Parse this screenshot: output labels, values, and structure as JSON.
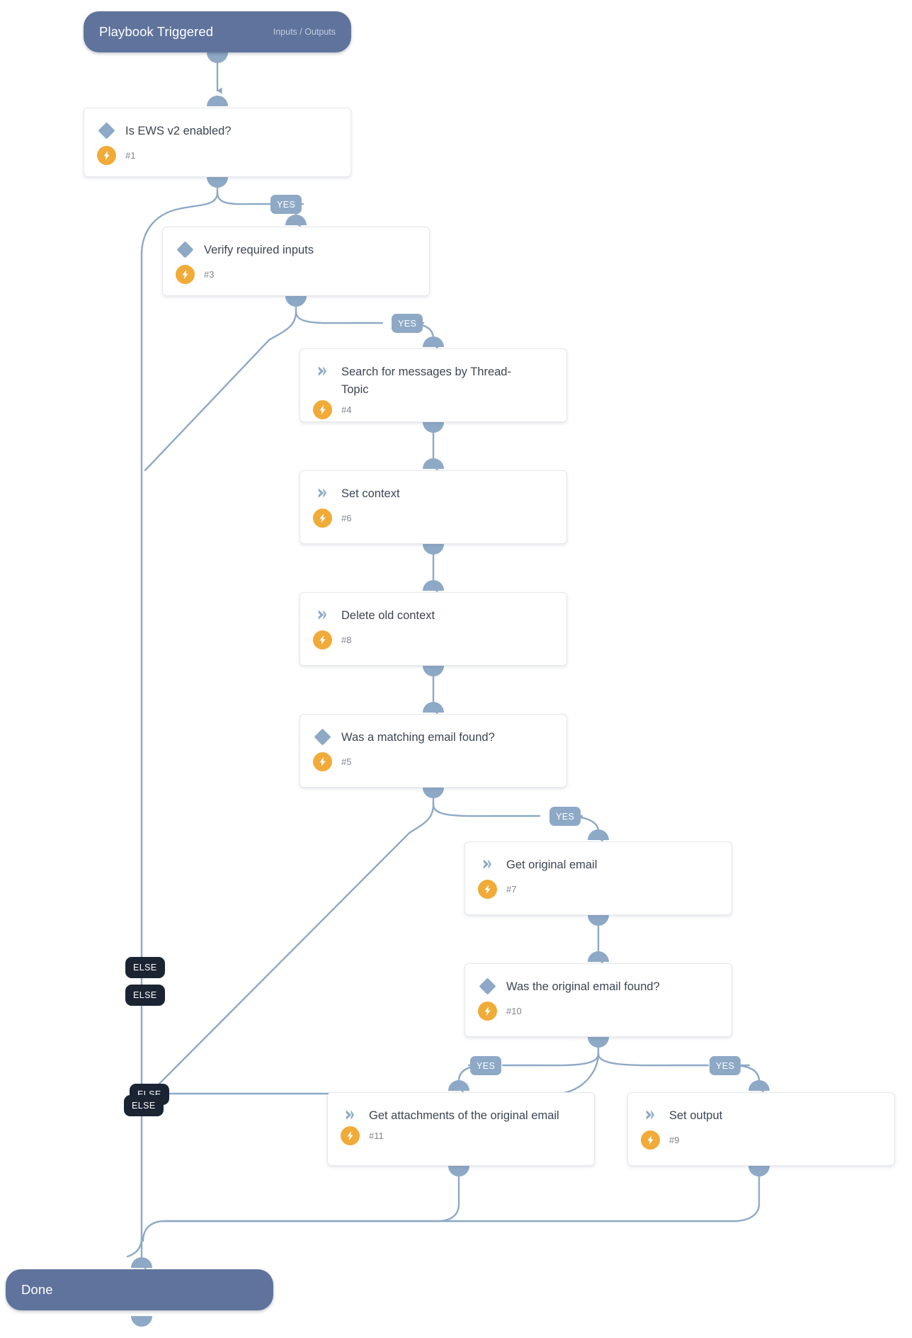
{
  "diagram": {
    "kind": "playbook-flowchart",
    "background": "#ffffff",
    "colors": {
      "terminal": "#5f739c",
      "connector": "#8ea9c6",
      "condition_icon": "#8ea9c6",
      "task_icon": "#8ea9c6",
      "bolt_badge": "#f0ab38",
      "yes_label": "#8ea9c6",
      "else_label": "#1b2433",
      "card_bg": "#ffffff",
      "card_border": "#e6e8ec",
      "title_text": "#3c4653",
      "number_text": "#7d858f"
    }
  },
  "start": {
    "title": "Playbook Triggered",
    "subtitle": "Inputs / Outputs"
  },
  "end": {
    "title": "Done"
  },
  "nodes": [
    {
      "id": "n1",
      "title": "Is EWS v2 enabled?",
      "number": "#1",
      "icon": "diamond-icon",
      "type": "condition"
    },
    {
      "id": "n3",
      "title": "Verify required inputs",
      "number": "#3",
      "icon": "diamond-icon",
      "type": "condition"
    },
    {
      "id": "n4",
      "title": "Search for messages by Thread-Topic",
      "number": "#4",
      "icon": "chevron-icon",
      "type": "task"
    },
    {
      "id": "n6",
      "title": "Set context",
      "number": "#6",
      "icon": "chevron-icon",
      "type": "task"
    },
    {
      "id": "n8",
      "title": "Delete old context",
      "number": "#8",
      "icon": "chevron-icon",
      "type": "task"
    },
    {
      "id": "n5",
      "title": "Was a matching email found?",
      "number": "#5",
      "icon": "diamond-icon",
      "type": "condition"
    },
    {
      "id": "n7",
      "title": "Get original email",
      "number": "#7",
      "icon": "chevron-icon",
      "type": "task"
    },
    {
      "id": "n10",
      "title": "Was the original email found?",
      "number": "#10",
      "icon": "diamond-icon",
      "type": "condition"
    },
    {
      "id": "n11",
      "title": "Get attachments of the original email",
      "number": "#11",
      "icon": "chevron-icon",
      "type": "task"
    },
    {
      "id": "n9",
      "title": "Set output",
      "number": "#9",
      "icon": "chevron-icon",
      "type": "task"
    }
  ],
  "edge_labels": [
    {
      "id": "yes1",
      "text": "YES",
      "from": "n1",
      "to": "n3"
    },
    {
      "id": "yes2",
      "text": "YES",
      "from": "n3",
      "to": "n4"
    },
    {
      "id": "yes3",
      "text": "YES",
      "from": "n5",
      "to": "n7"
    },
    {
      "id": "yes4",
      "text": "YES",
      "from": "n10",
      "to": "n11"
    },
    {
      "id": "yes5",
      "text": "YES",
      "from": "n10",
      "to": "n9"
    },
    {
      "id": "else1",
      "text": "ELSE",
      "from": "n1",
      "to": "end"
    },
    {
      "id": "else2",
      "text": "ELSE",
      "from": "n3",
      "to": "end"
    },
    {
      "id": "else3",
      "text": "ELSE",
      "from": "n5",
      "to": "end"
    },
    {
      "id": "else4",
      "text": "ELSE",
      "from": "n10",
      "to": "end"
    }
  ]
}
